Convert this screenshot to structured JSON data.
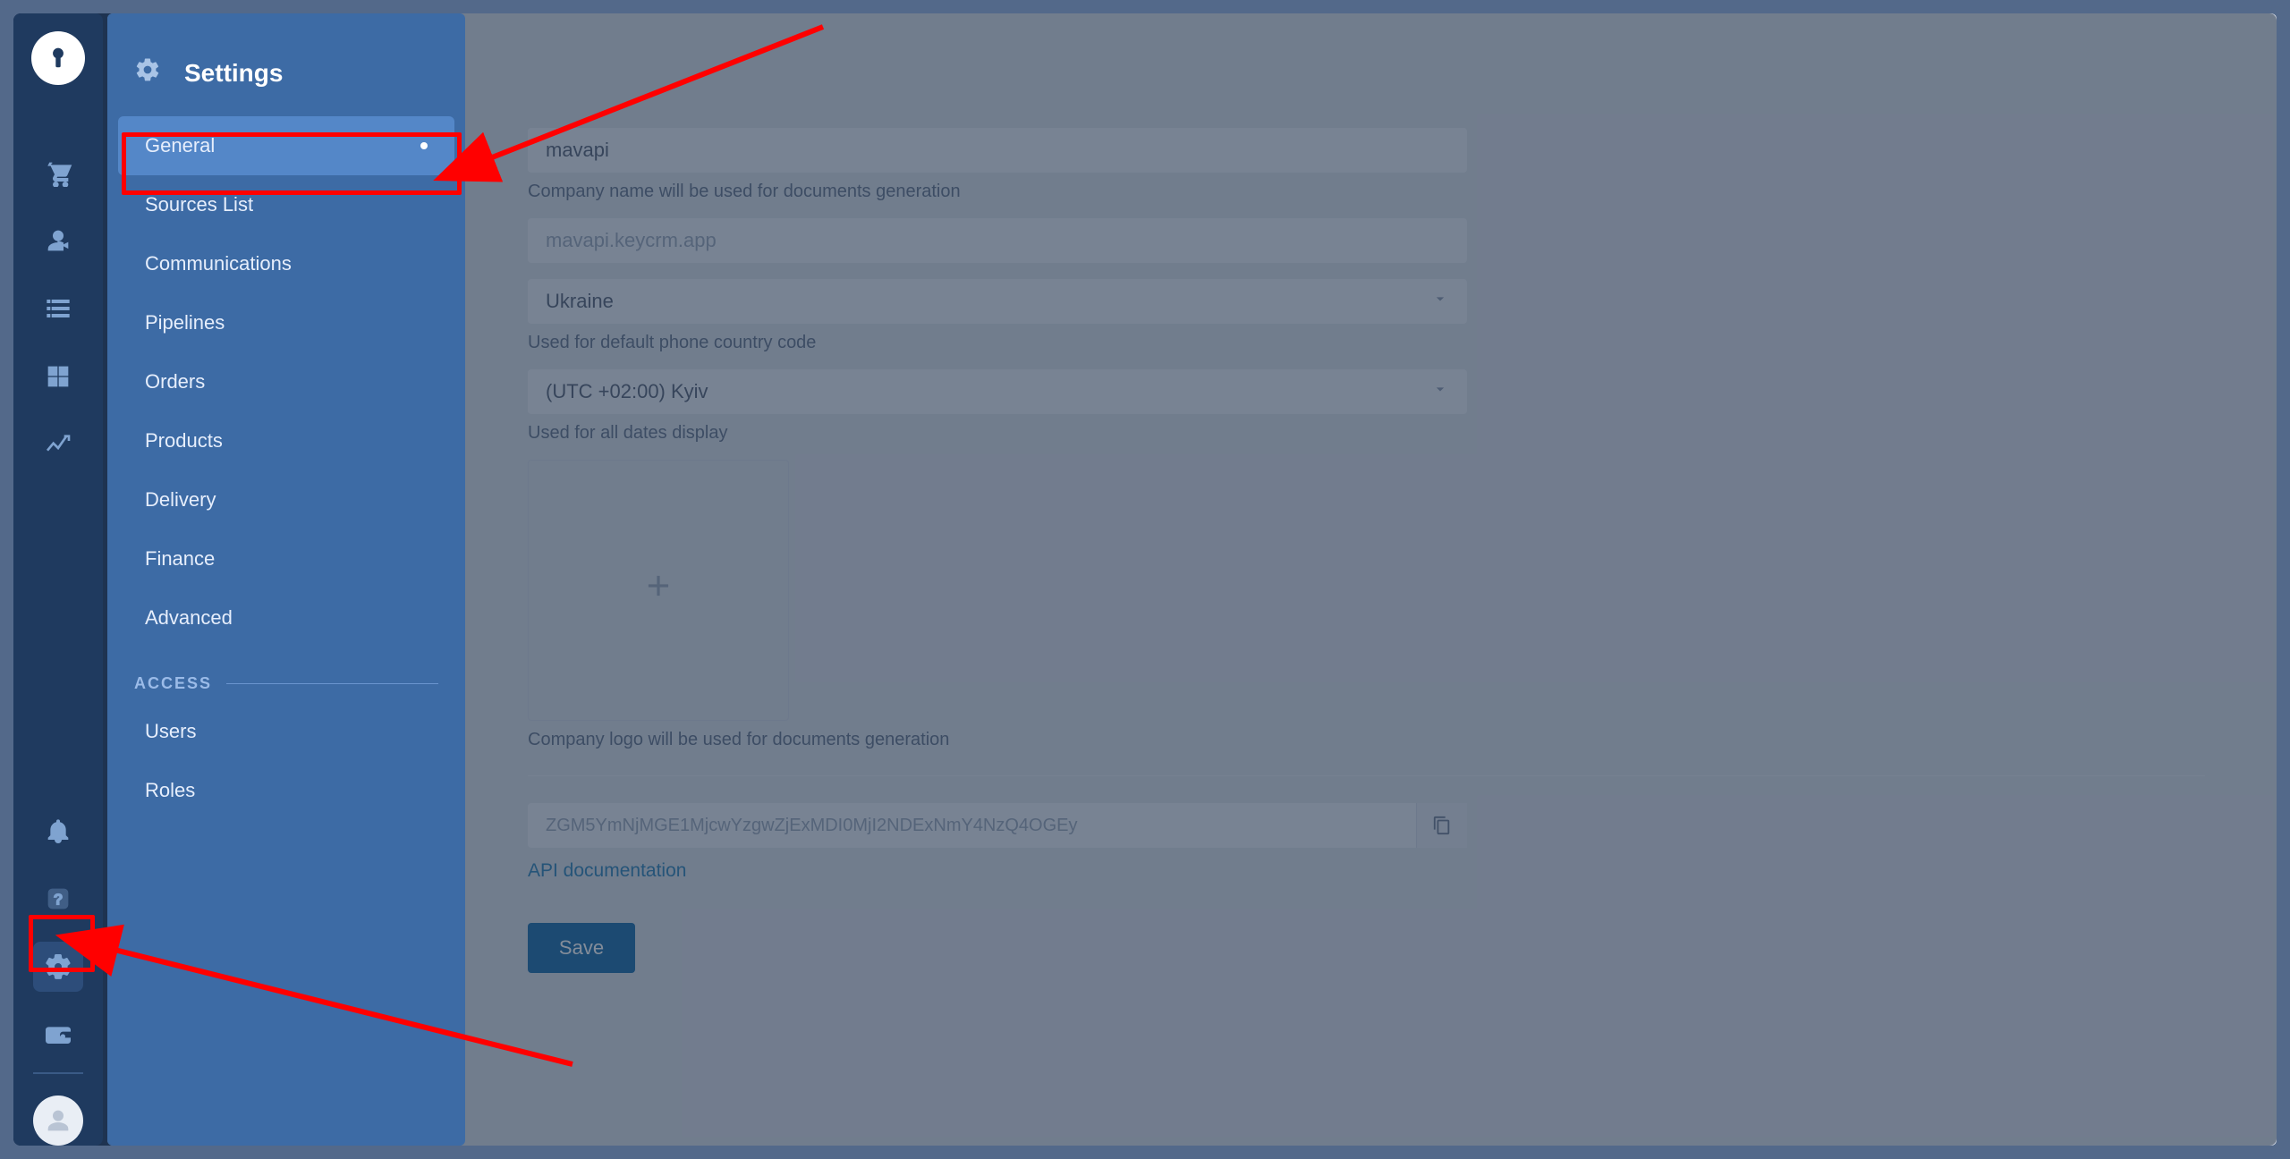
{
  "page_title": "Settings",
  "submenu": {
    "title": "Settings",
    "items": [
      {
        "label": "General",
        "active": true
      },
      {
        "label": "Sources List"
      },
      {
        "label": "Communications"
      },
      {
        "label": "Pipelines"
      },
      {
        "label": "Orders"
      },
      {
        "label": "Products"
      },
      {
        "label": "Delivery"
      },
      {
        "label": "Finance"
      },
      {
        "label": "Advanced"
      }
    ],
    "access_group_label": "ACCESS",
    "access_items": [
      {
        "label": "Users"
      },
      {
        "label": "Roles"
      }
    ]
  },
  "form": {
    "company_name": "mavapi",
    "company_name_hint": "Company name will be used for documents generation",
    "subdomain": "mavapi.keycrm.app",
    "country": "Ukraine",
    "country_hint": "Used for default phone country code",
    "timezone": "(UTC +02:00) Kyiv",
    "timezone_hint": "Used for all dates display",
    "logo_hint": "Company logo will be used for documents generation",
    "api_key": "ZGM5YmNjMGE1MjcwYzgwZjExMDI0MjI2NDExNmY4NzQ4OGEy",
    "api_doc_label": "API documentation",
    "save_label": "Save"
  },
  "rail": {
    "icons": [
      "logo",
      "cart",
      "contacts",
      "tasks",
      "inventory",
      "analytics"
    ],
    "bottom_icons": [
      "notifications",
      "help",
      "settings",
      "wallet",
      "avatar"
    ]
  }
}
